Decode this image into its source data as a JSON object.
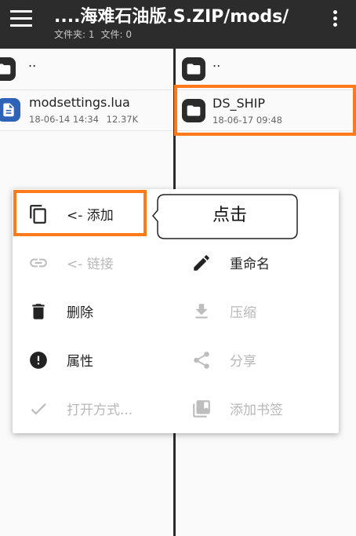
{
  "appbar": {
    "title": "....海难石油版.S.ZIP/mods/",
    "folders_count": "文件夹: 1",
    "files_count": "文件: 0"
  },
  "left_pane": {
    "parent": "..",
    "items": [
      {
        "name": "modsettings.lua",
        "date": "18-06-14 14:34",
        "size": "12.37K",
        "icon": "document-icon"
      }
    ]
  },
  "right_pane": {
    "parent": "..",
    "items": [
      {
        "name": "DS_SHIP",
        "date": "18-06-17 09:48",
        "icon": "folder-icon"
      }
    ]
  },
  "context_menu": {
    "items": [
      {
        "label": "<- 添加",
        "icon": "copy-icon",
        "enabled": true
      },
      {
        "label": "",
        "icon": "",
        "enabled": false
      },
      {
        "label": "<- 链接",
        "icon": "link-icon",
        "enabled": false
      },
      {
        "label": "重命名",
        "icon": "pencil-icon",
        "enabled": true
      },
      {
        "label": "删除",
        "icon": "trash-icon",
        "enabled": true
      },
      {
        "label": "压缩",
        "icon": "download-icon",
        "enabled": false
      },
      {
        "label": "属性",
        "icon": "info-icon",
        "enabled": true
      },
      {
        "label": "分享",
        "icon": "share-icon",
        "enabled": false
      },
      {
        "label": "打开方式...",
        "icon": "check-icon",
        "enabled": false
      },
      {
        "label": "添加书签",
        "icon": "bookmark-icon",
        "enabled": false
      }
    ]
  },
  "callout": {
    "text": "点击"
  },
  "colors": {
    "appbar": "#2c2c2c",
    "highlight": "#ff7a1a",
    "file_icon": "#2f63b8",
    "disabled_text": "#b8b8b8"
  }
}
